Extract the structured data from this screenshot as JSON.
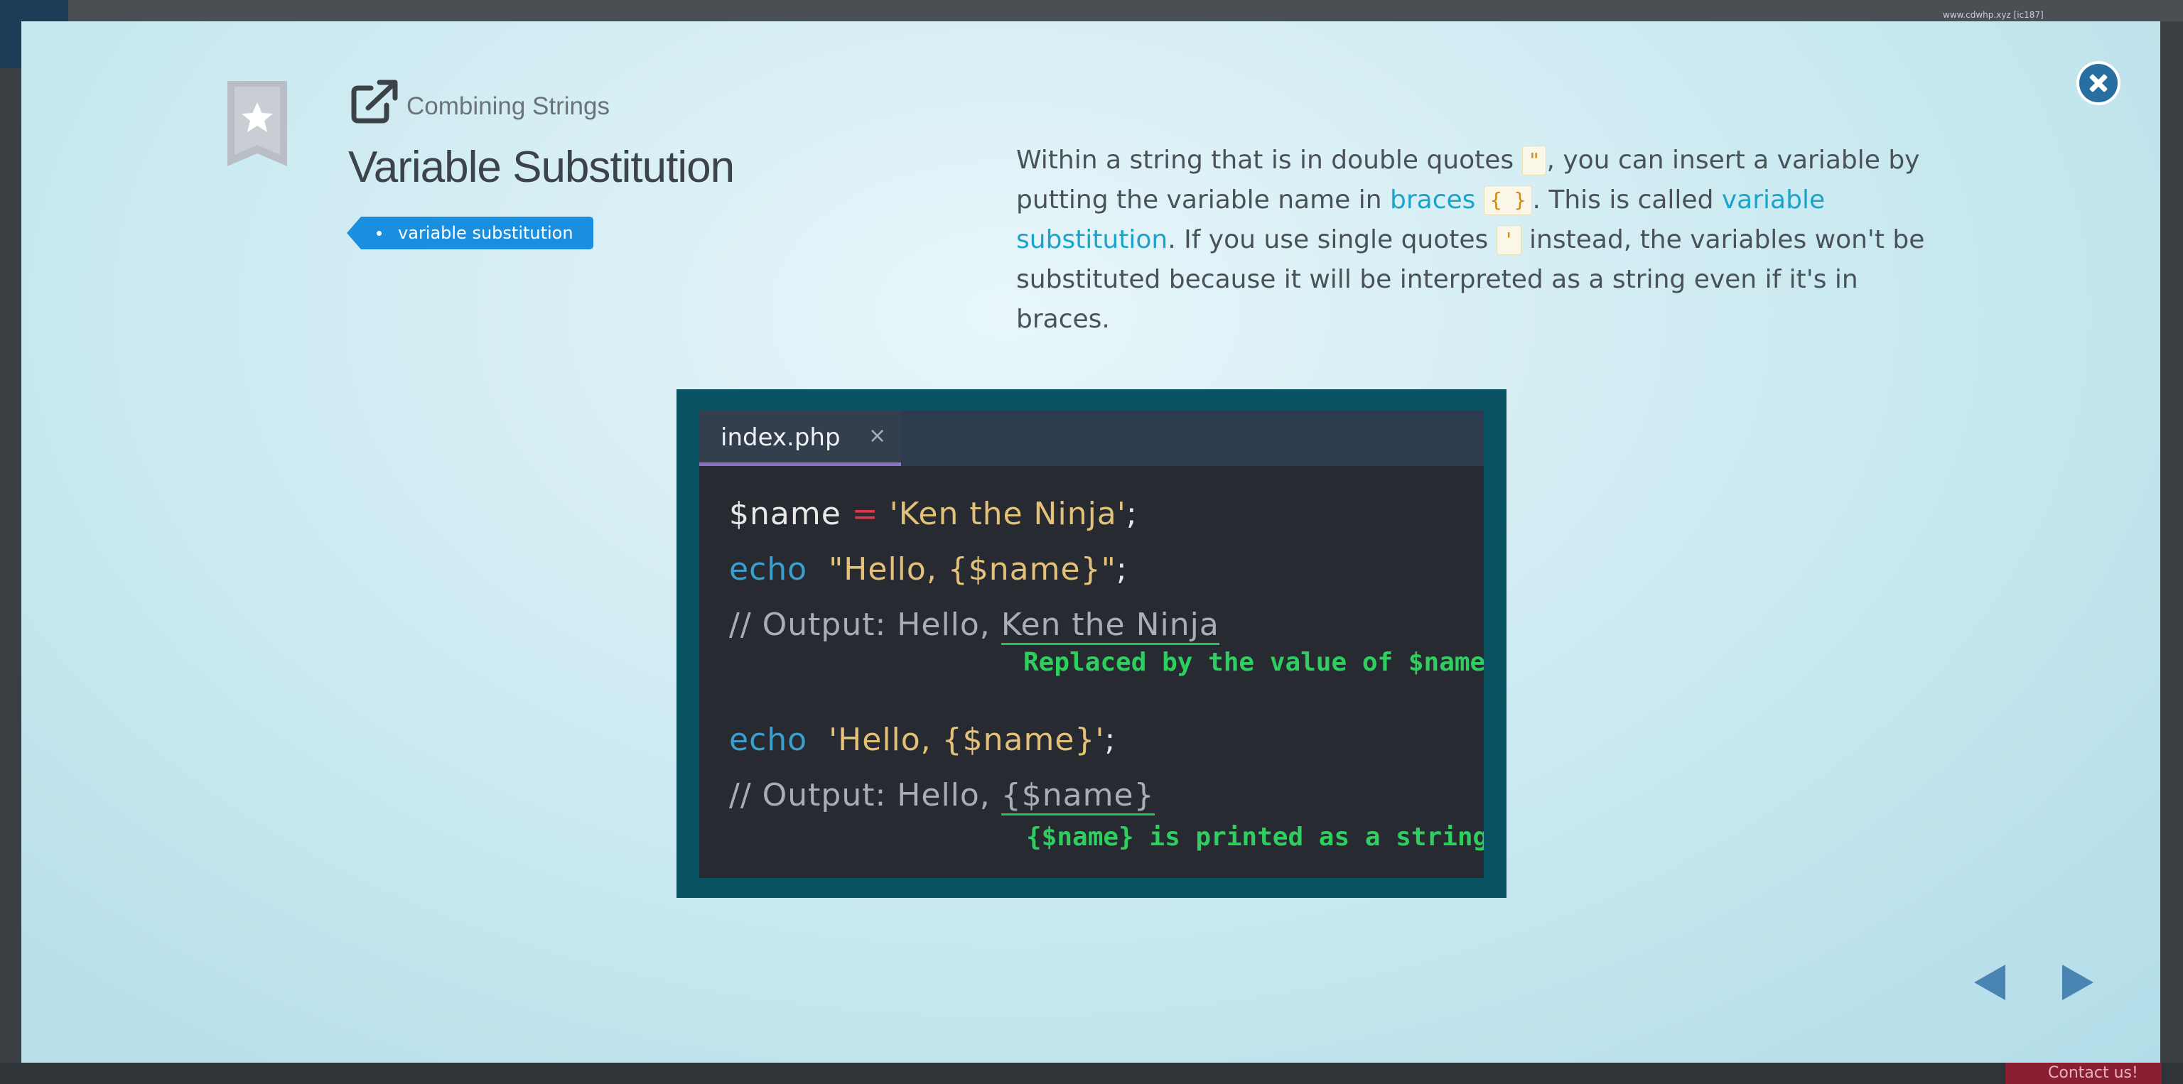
{
  "modal": {
    "lesson_name": "Combining Strings",
    "title": "Variable Substitution",
    "tag": "variable substitution",
    "description": {
      "p1": "Within a string that is in double quotes ",
      "code_dq": "\"",
      "p2": ", you can insert a variable by putting the variable name in ",
      "kw_braces": "braces",
      "code_braces": "{ }",
      "p3": ". This is called ",
      "kw_varsub": "variable substitution",
      "p4": ". If you use single quotes ",
      "code_sq": "'",
      "p5": " instead, the variables won't be substituted because it will be interpreted as a string even if it's in braces."
    }
  },
  "slide": {
    "tab_name": "index.php",
    "tab_close": "×",
    "line1": {
      "var": "$name",
      "op": "=",
      "str": "'Ken the Ninja'",
      "end": ";"
    },
    "line2": {
      "kw": "echo",
      "str": "\"Hello, {$name}\"",
      "end": ";"
    },
    "line3": {
      "prefix": "// Output: Hello, ",
      "value": "Ken the Ninja"
    },
    "note1": "Replaced by the value of $name",
    "line4": {
      "kw": "echo",
      "str": "'Hello, {$name}'",
      "end": ";"
    },
    "line5": {
      "prefix": "// Output: Hello, ",
      "value": "{$name}"
    },
    "note2": "{$name} is printed as a string"
  },
  "background": {
    "url": "www.cdwhp.xyz [ic187]",
    "contact": "Contact us!"
  },
  "colors": {
    "accent": "#1a8fe0",
    "close_button": "#266fa0",
    "slide_frame": "#0a5365",
    "editor_bg": "#272b31",
    "highlight_green": "#2ecf5f"
  },
  "icons": {
    "bookmark": "bookmark-star-icon",
    "header": "external-link-icon",
    "close": "close-icon",
    "prev": "triangle-left-icon",
    "next": "triangle-right-icon"
  }
}
